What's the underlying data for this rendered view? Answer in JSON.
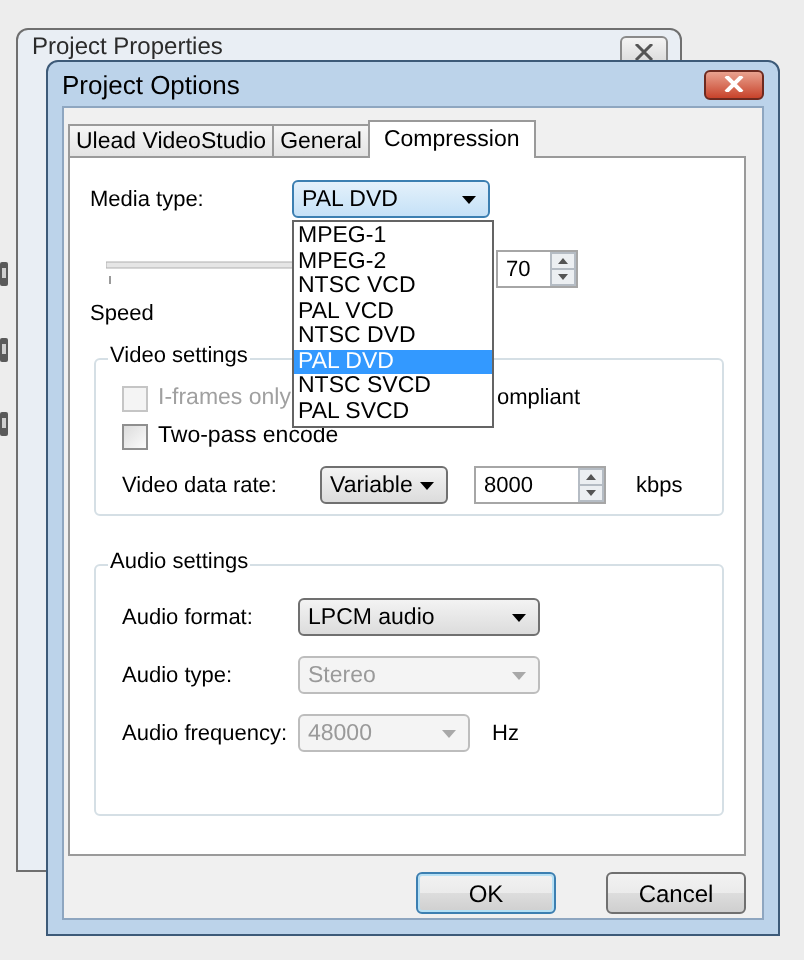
{
  "back_window": {
    "title": "Project Properties"
  },
  "dialog": {
    "title": "Project Options",
    "tabs": [
      {
        "label": "Ulead VideoStudio",
        "selected": false
      },
      {
        "label": "General",
        "selected": false
      },
      {
        "label": "Compression",
        "selected": true
      }
    ],
    "media_type": {
      "label": "Media type:",
      "value": "PAL DVD",
      "expanded": true,
      "options": [
        {
          "label": "MPEG-1",
          "selected": false
        },
        {
          "label": "MPEG-2",
          "selected": false
        },
        {
          "label": "NTSC VCD",
          "selected": false
        },
        {
          "label": "PAL VCD",
          "selected": false
        },
        {
          "label": "NTSC DVD",
          "selected": false
        },
        {
          "label": "PAL DVD",
          "selected": true
        },
        {
          "label": "NTSC SVCD",
          "selected": false
        },
        {
          "label": "PAL SVCD",
          "selected": false
        }
      ]
    },
    "quality": {
      "value": "70"
    },
    "speed_label": "Speed",
    "video_settings": {
      "title": "Video settings",
      "iframes": {
        "label": "I-frames only",
        "checked": false,
        "disabled": true
      },
      "compliant_fragment": "ompliant",
      "two_pass": {
        "label": "Two-pass encode",
        "checked": false,
        "disabled": false
      },
      "data_rate": {
        "label": "Video data rate:",
        "mode": "Variable",
        "value": "8000",
        "unit": "kbps"
      }
    },
    "audio_settings": {
      "title": "Audio settings",
      "rows": [
        {
          "label": "Audio format:",
          "value": "LPCM audio",
          "disabled": false,
          "kind": "wide"
        },
        {
          "label": "Audio type:",
          "value": "Stereo",
          "disabled": true,
          "kind": "wide"
        },
        {
          "label": "Audio frequency:",
          "value": "48000",
          "disabled": true,
          "kind": "narrow",
          "unit": "Hz"
        }
      ]
    },
    "buttons": [
      {
        "label": "OK",
        "default": true
      },
      {
        "label": "Cancel",
        "default": false
      }
    ]
  }
}
